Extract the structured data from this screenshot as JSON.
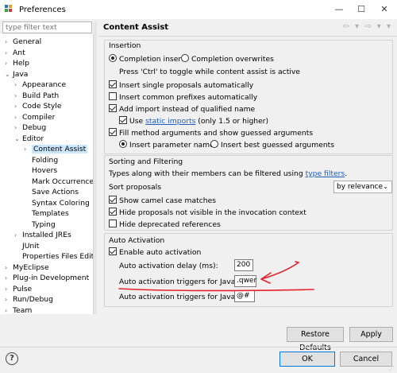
{
  "window": {
    "title": "Preferences",
    "controls": [
      "—",
      "☐",
      "✕"
    ]
  },
  "filter": {
    "placeholder": "type filter text"
  },
  "tree": {
    "items": [
      {
        "label": "General",
        "arrow": "›"
      },
      {
        "label": "Ant",
        "arrow": "›"
      },
      {
        "label": "Help",
        "arrow": "›"
      },
      {
        "label": "Java",
        "arrow": "⌄"
      },
      {
        "label": "Appearance",
        "arrow": "›"
      },
      {
        "label": "Build Path",
        "arrow": "›"
      },
      {
        "label": "Code Style",
        "arrow": "›"
      },
      {
        "label": "Compiler",
        "arrow": "›"
      },
      {
        "label": "Debug",
        "arrow": "›"
      },
      {
        "label": "Editor",
        "arrow": "⌄"
      },
      {
        "label": "Content Assist",
        "arrow": "›"
      },
      {
        "label": "Folding",
        "arrow": ""
      },
      {
        "label": "Hovers",
        "arrow": ""
      },
      {
        "label": "Mark Occurrences",
        "arrow": ""
      },
      {
        "label": "Save Actions",
        "arrow": ""
      },
      {
        "label": "Syntax Coloring",
        "arrow": ""
      },
      {
        "label": "Templates",
        "arrow": ""
      },
      {
        "label": "Typing",
        "arrow": ""
      },
      {
        "label": "Installed JREs",
        "arrow": "›"
      },
      {
        "label": "JUnit",
        "arrow": ""
      },
      {
        "label": "Properties Files Edito",
        "arrow": ""
      },
      {
        "label": "MyEclipse",
        "arrow": "›"
      },
      {
        "label": "Plug-in Development",
        "arrow": "›"
      },
      {
        "label": "Pulse",
        "arrow": "›"
      },
      {
        "label": "Run/Debug",
        "arrow": "›"
      },
      {
        "label": "Team",
        "arrow": "›"
      }
    ]
  },
  "panel": {
    "title": "Content Assist",
    "nav": "⇦ ▾ ⇨ ▾ ▾",
    "insertion": {
      "title": "Insertion",
      "completion_inserts": "Completion inserts",
      "completion_overwrites": "Completion overwrites",
      "toggle_hint": "Press 'Ctrl' to toggle while content assist is active",
      "single_proposals": "Insert single proposals automatically",
      "common_prefixes": "Insert common prefixes automatically",
      "add_import": "Add import instead of qualified name",
      "use": "Use",
      "static_imports": "static imports",
      "only_15": "(only 1.5 or higher)",
      "fill_method": "Fill method arguments and show guessed arguments",
      "insert_param_names": "Insert parameter names",
      "insert_best_guessed": "Insert best guessed arguments"
    },
    "sorting": {
      "title": "Sorting and Filtering",
      "types_text": "Types along with their members can be filtered using",
      "type_filters": "type filters",
      "period": ".",
      "sort_proposals": "Sort proposals",
      "sort_value": "by relevance",
      "camel_case": "Show camel case matches",
      "hide_not_visible": "Hide proposals not visible in the invocation context",
      "hide_deprecated": "Hide deprecated references"
    },
    "auto": {
      "title": "Auto Activation",
      "enable": "Enable auto activation",
      "delay_label": "Auto activation delay (ms):",
      "delay_value": "200",
      "java_label": "Auto activation triggers for Java:",
      "java_value": ".qwer",
      "javadoc_label": "Auto activation triggers for Javadoc:",
      "javadoc_value": "@#"
    },
    "restore_defaults": "Restore Defaults",
    "apply": "Apply"
  },
  "footer": {
    "help": "?",
    "ok": "OK",
    "cancel": "Cancel"
  },
  "colors": {
    "annotation": "#e8202a",
    "selection": "#cce8ff",
    "link": "#1f5fbf"
  }
}
